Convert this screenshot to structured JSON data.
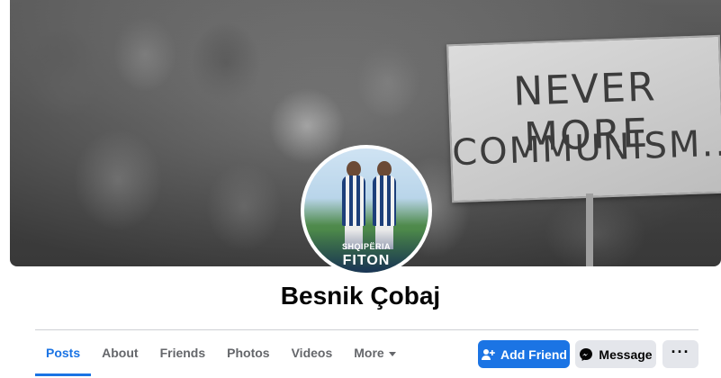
{
  "cover": {
    "sign_line1": "NEVER MORE",
    "sign_line2": "COMMUNISM.."
  },
  "avatar": {
    "overlay_line1": "SHQIPËRIA",
    "overlay_line2": "FITON"
  },
  "profile": {
    "name": "Besnik Çobaj"
  },
  "tabs": [
    {
      "label": "Posts",
      "active": true
    },
    {
      "label": "About",
      "active": false
    },
    {
      "label": "Friends",
      "active": false
    },
    {
      "label": "Photos",
      "active": false
    },
    {
      "label": "Videos",
      "active": false
    },
    {
      "label": "More",
      "active": false
    }
  ],
  "actions": {
    "add_friend": "Add Friend",
    "message": "Message",
    "more": "···"
  },
  "colors": {
    "accent": "#1b74e4",
    "secondary_button": "#e4e6eb",
    "tab_inactive": "#65676b"
  },
  "icons": {
    "add_friend": "add-friend-icon",
    "message": "messenger-icon",
    "more_tab": "caret-down-icon"
  }
}
